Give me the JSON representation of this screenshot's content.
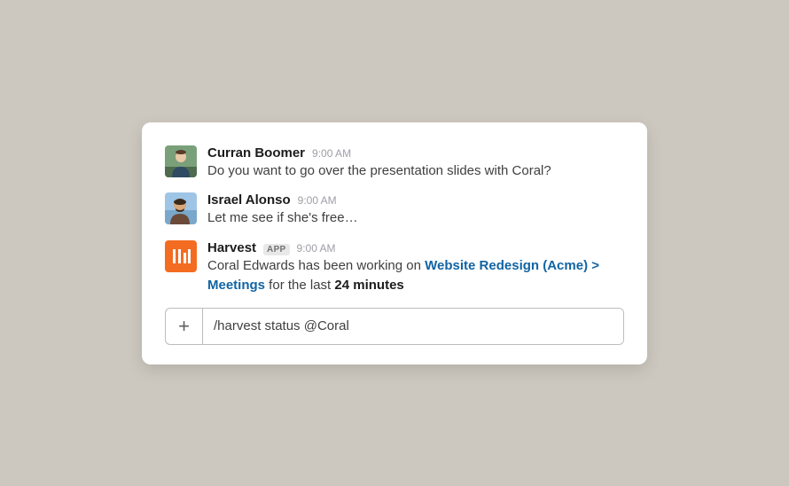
{
  "messages": [
    {
      "author": "Curran Boomer",
      "time": "9:00 AM",
      "text": "Do you want to go over the presentation slides with Coral?"
    },
    {
      "author": "Israel Alonso",
      "time": "9:00 AM",
      "text": "Let me see if she's free…"
    },
    {
      "author": "Harvest",
      "app_badge": "APP",
      "time": "9:00 AM",
      "text_prefix": "Coral Edwards has been working on ",
      "link_a": "Website Redesign (Acme)",
      "link_sep": " > ",
      "link_b": "Meetings",
      "text_mid": " for the last ",
      "bold": "24 minutes"
    }
  ],
  "composer": {
    "value": "/harvest status @Coral",
    "add_icon": "+"
  },
  "colors": {
    "harvest_orange": "#f36c21",
    "link_blue": "#1264a3"
  }
}
